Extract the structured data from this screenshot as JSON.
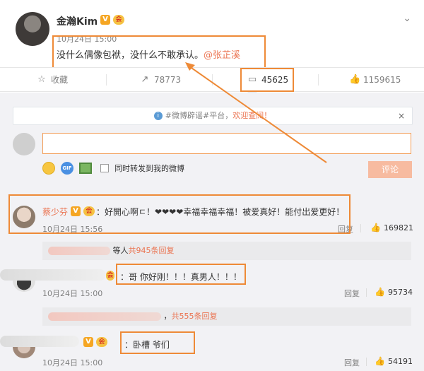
{
  "post": {
    "author": "金瀚Kim",
    "v_badge": "V",
    "vip_badge": "会",
    "time": "10月24日 15:00",
    "text": "没什么偶像包袱，没什么不敢承认。",
    "mention": "@张芷溪"
  },
  "actions": [
    {
      "icon": "☆",
      "label": "收藏"
    },
    {
      "icon": "↗",
      "label": "78773"
    },
    {
      "icon": "▭",
      "label": "45625"
    },
    {
      "icon": "👍",
      "label": "1159615"
    }
  ],
  "comment_box": {
    "notice_text": "#微博辟谣#平台，",
    "notice_link": "欢迎查阅！",
    "notice_close": "×",
    "repost_label": "同时转发到我的微博",
    "submit_label": "评论"
  },
  "comments": [
    {
      "name": "蔡少芬",
      "text": "：好開心啊ㄷ！❤❤❤❤幸福幸福幸福！被爱真好！能付出爱更好！",
      "time": "10月24日 15:56",
      "reply": "回复",
      "likes": "169821",
      "sub_prefix": "等人",
      "sub_count": "共945条回复"
    },
    {
      "name": "",
      "text": "：哥 你好刚！！！真男人！！！",
      "time": "10月24日 15:00",
      "reply": "回复",
      "likes": "95734",
      "sub_prefix": "，",
      "sub_count": "共555条回复"
    },
    {
      "name": "",
      "text": "：卧槽 爷们",
      "time": "10月24日 15:00",
      "reply": "回复",
      "likes": "54191"
    }
  ],
  "colors": {
    "highlight": "#ee8a37",
    "link": "#eb7350",
    "submit": "#f7bba0"
  }
}
